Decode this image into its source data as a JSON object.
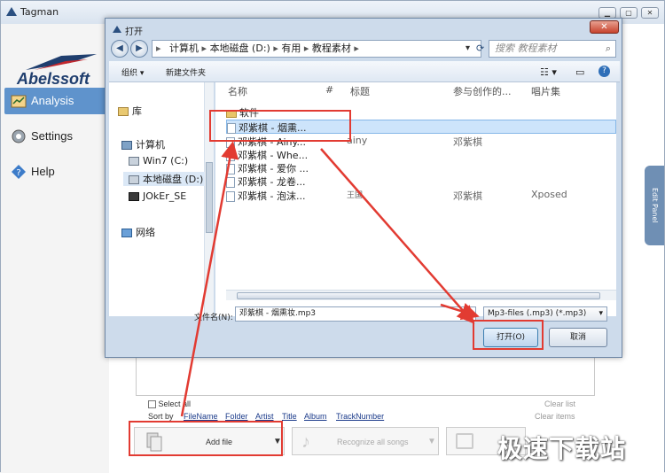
{
  "app": {
    "title": "Tagman",
    "logo_text": "Abelssoft",
    "nav": [
      {
        "label": "Analysis",
        "icon": "analysis-icon"
      },
      {
        "label": "Settings",
        "icon": "settings-gear-icon"
      },
      {
        "label": "Help",
        "icon": "help-diamond-icon"
      }
    ],
    "edit_panel_label": "Edit Panel",
    "select_all": "Select all",
    "sort_by": "Sort by",
    "sort_fields": [
      "FileName",
      "Folder",
      "Artist",
      "Title",
      "Album",
      "TrackNumber"
    ],
    "clear_list": "Clear list",
    "clear_items": "Clear items",
    "add_file": "Add file",
    "recognize_all": "Recognize all songs",
    "save_partial": "Sa"
  },
  "dialog": {
    "title": "打开",
    "breadcrumb": [
      "计算机",
      "本地磁盘 (D:)",
      "有用",
      "教程素材"
    ],
    "search_placeholder": "搜索 教程素材",
    "toolbar": {
      "organize": "组织 ▾",
      "new_folder": "新建文件夹"
    },
    "left_pane": [
      {
        "label": "库",
        "icon": "library-icon"
      },
      {
        "label": "计算机",
        "icon": "computer-icon"
      },
      {
        "label": "Win7 (C:)",
        "icon": "drive-icon"
      },
      {
        "label": "本地磁盘 (D:)",
        "icon": "drive-icon"
      },
      {
        "label": "JOkEr_SE",
        "icon": "drive-icon"
      },
      {
        "label": "网络",
        "icon": "network-icon"
      }
    ],
    "columns": [
      "名称",
      "#",
      "标题",
      "参与创作的...",
      "唱片集"
    ],
    "files": [
      {
        "name": "软件",
        "title": "",
        "artist": "",
        "album": "",
        "type": "folder"
      },
      {
        "name": "邓紫棋 - 烟熏...",
        "title": "",
        "artist": "",
        "album": "",
        "type": "file",
        "selected": true
      },
      {
        "name": "邓紫棋 - Ainy...",
        "title": "ainy",
        "artist": "邓紫棋",
        "album": "",
        "type": "file"
      },
      {
        "name": "邓紫棋 - Whe...",
        "title": "",
        "artist": "",
        "album": "",
        "type": "file"
      },
      {
        "name": "邓紫棋 - 爱你 ...",
        "title": "",
        "artist": "",
        "album": "",
        "type": "file"
      },
      {
        "name": "邓紫棋 - 龙卷...",
        "title": "",
        "artist": "",
        "album": "",
        "type": "file"
      },
      {
        "name": "邓紫棋 - 泡沫...",
        "title": "王国",
        "artist": "邓紫棋",
        "album": "Xposed",
        "type": "file"
      }
    ],
    "filename_label": "文件名(N):",
    "filename_value": "邓紫棋 - 烟熏妆.mp3",
    "filter_value": "Mp3-files (.mp3) (*.mp3)",
    "open_button": "打开(O)",
    "cancel_button": "取消"
  },
  "watermark": "极速下载站",
  "colors": {
    "accent": "#5f93cc",
    "highlight_box": "#e23b32"
  }
}
